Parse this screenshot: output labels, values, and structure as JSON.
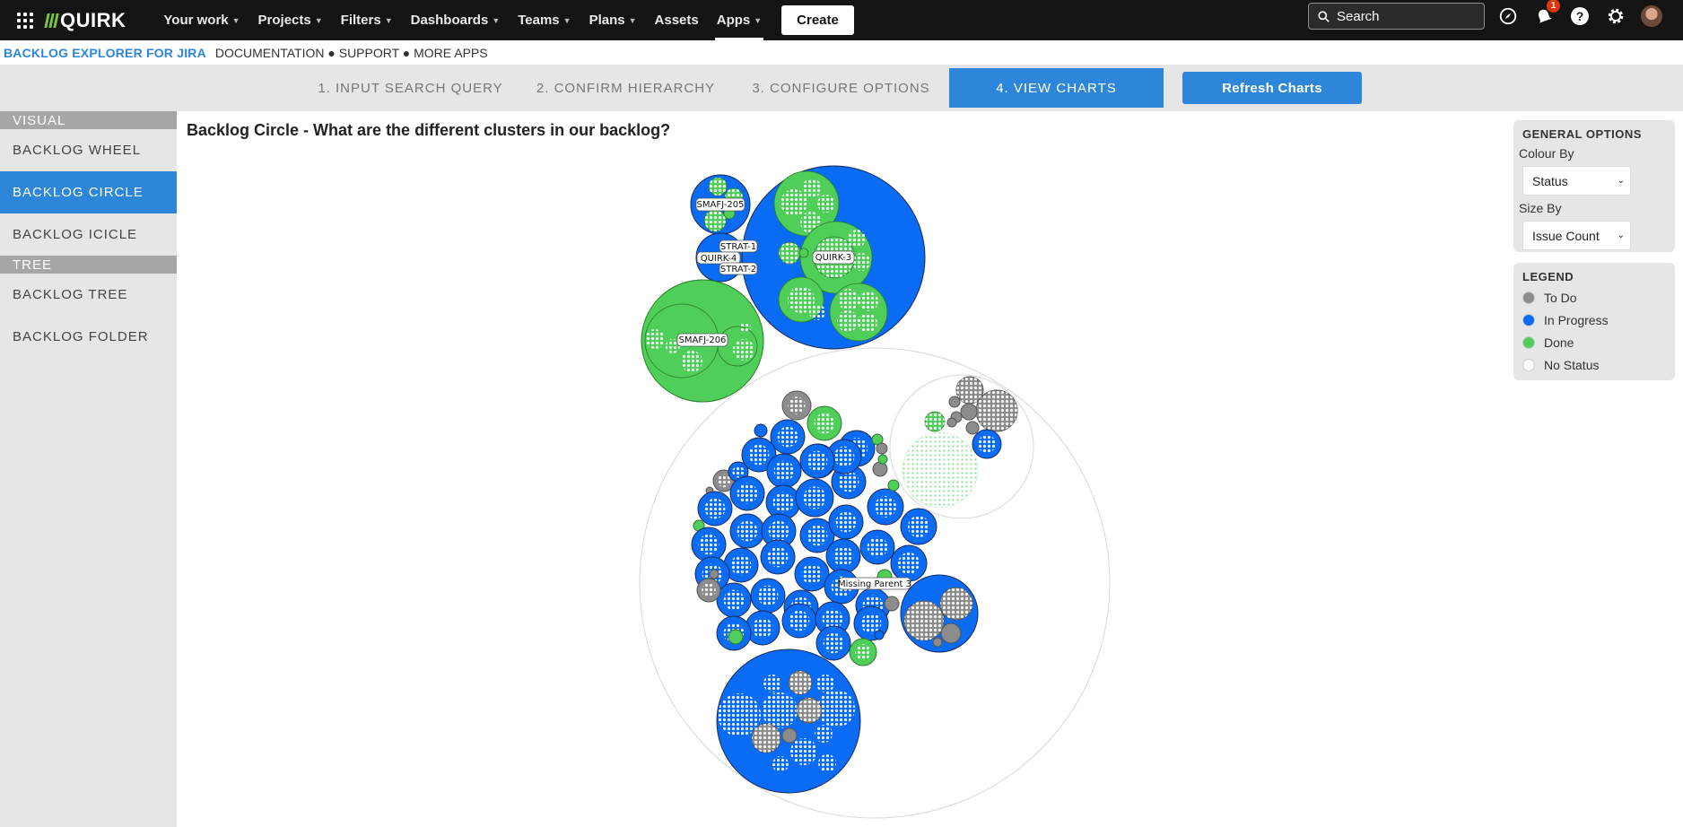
{
  "topnav": {
    "logo_text": "QUIRK",
    "items": [
      {
        "label": "Your work"
      },
      {
        "label": "Projects"
      },
      {
        "label": "Filters"
      },
      {
        "label": "Dashboards"
      },
      {
        "label": "Teams"
      },
      {
        "label": "Plans"
      },
      {
        "label": "Assets"
      },
      {
        "label": "Apps"
      }
    ],
    "create_label": "Create",
    "search_placeholder": "Search",
    "notification_count": "1"
  },
  "subheader": {
    "brand": "BACKLOG EXPLORER FOR JIRA",
    "links": "DOCUMENTATION ● SUPPORT ● MORE APPS"
  },
  "steps": [
    {
      "label": "1. INPUT SEARCH QUERY"
    },
    {
      "label": "2. CONFIRM HIERARCHY"
    },
    {
      "label": "3. CONFIGURE OPTIONS"
    },
    {
      "label": "4. VIEW CHARTS"
    }
  ],
  "refresh_label": "Refresh Charts",
  "sidebar": {
    "visual_heading": "VISUAL",
    "visual_items": [
      {
        "label": "BACKLOG WHEEL"
      },
      {
        "label": "BACKLOG CIRCLE"
      },
      {
        "label": "BACKLOG ICICLE"
      }
    ],
    "tree_heading": "TREE",
    "tree_items": [
      {
        "label": "BACKLOG TREE"
      },
      {
        "label": "BACKLOG FOLDER"
      }
    ]
  },
  "chart": {
    "title": "Backlog Circle - What are the different clusters in our backlog?",
    "labels": {
      "smafj205": "SMAFJ-205",
      "strat1": "STRAT-1",
      "quirk4": "QUIRK-4",
      "strat2": "STRAT-2",
      "quirk3": "QUIRK-3",
      "smafj206": "SMAFJ-206",
      "missing": "Missing Parent 3"
    }
  },
  "general_options": {
    "title": "GENERAL OPTIONS",
    "colour_by_label": "Colour By",
    "colour_by_value": "Status",
    "size_by_label": "Size By",
    "size_by_value": "Issue Count"
  },
  "legend": {
    "title": "LEGEND",
    "items": [
      {
        "label": "To Do",
        "color": "#8c8c8c"
      },
      {
        "label": "In Progress",
        "color": "#0a6cf5"
      },
      {
        "label": "Done",
        "color": "#4fce5a"
      },
      {
        "label": "No Status",
        "color": "#ffffff"
      }
    ]
  },
  "colors": {
    "accent": "#2d86d9",
    "todo": "#8c8c8c",
    "in_progress": "#0a6cf5",
    "done": "#4fce5a"
  }
}
